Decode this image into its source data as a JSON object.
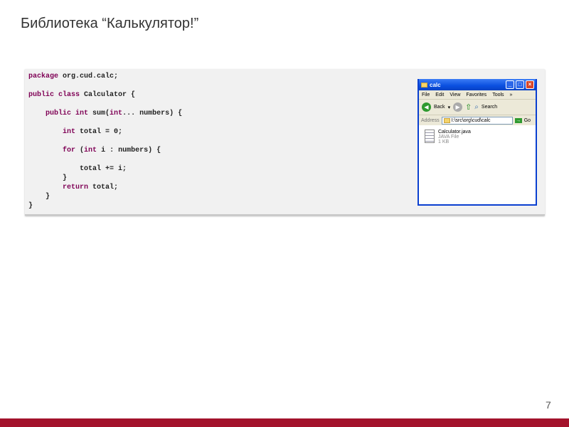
{
  "title": "Библиотека “Калькулятор!”",
  "code": [
    [
      {
        "t": "package",
        "kw": true
      },
      {
        "t": " org.cud.calc;"
      }
    ],
    [],
    [
      {
        "t": "public class",
        "kw": true
      },
      {
        "t": " Calculator {"
      }
    ],
    [],
    [
      {
        "t": "    "
      },
      {
        "t": "public int",
        "kw": true
      },
      {
        "t": " sum("
      },
      {
        "t": "int",
        "kw": true
      },
      {
        "t": "... numbers) {"
      }
    ],
    [],
    [
      {
        "t": "        "
      },
      {
        "t": "int",
        "kw": true
      },
      {
        "t": " total = 0;"
      }
    ],
    [],
    [
      {
        "t": "        "
      },
      {
        "t": "for",
        "kw": true
      },
      {
        "t": " ("
      },
      {
        "t": "int",
        "kw": true
      },
      {
        "t": " i : numbers) {"
      }
    ],
    [],
    [
      {
        "t": "            total += i;"
      }
    ],
    [
      {
        "t": "        }"
      }
    ],
    [
      {
        "t": "        "
      },
      {
        "t": "return",
        "kw": true
      },
      {
        "t": " total;"
      }
    ],
    [
      {
        "t": "    }"
      }
    ],
    [
      {
        "t": "}"
      }
    ]
  ],
  "explorer": {
    "title": "calc",
    "menu": [
      "File",
      "Edit",
      "View",
      "Favorites",
      "Tools"
    ],
    "back": "Back",
    "search": "Search",
    "address_label": "Address",
    "address": "I:\\src\\org\\cud\\calc",
    "go": "Go",
    "file": {
      "name": "Calculator.java",
      "type": "JAVA File",
      "size": "1 KB"
    }
  },
  "page_number": "7",
  "colors": {
    "keyword": "#7f0055",
    "footer": "#a3132c"
  }
}
